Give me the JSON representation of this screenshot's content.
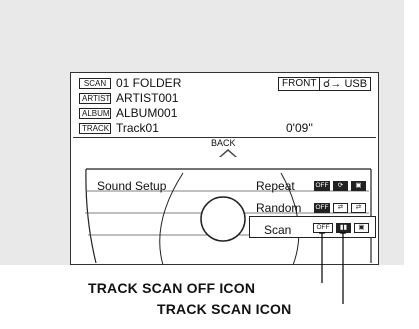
{
  "screen": {
    "rows": [
      {
        "tag": "SCAN",
        "text": "01 FOLDER"
      },
      {
        "tag": "ARTIST",
        "text": "ARTIST001"
      },
      {
        "tag": "ALBUM",
        "text": "ALBUM001"
      },
      {
        "tag": "TRACK",
        "text": "Track01"
      }
    ],
    "time": "0'09''",
    "source_front": "FRONT",
    "source_usb": "USB",
    "back_label": "BACK"
  },
  "menu": {
    "sound_setup": "Sound Setup",
    "repeat": "Repeat",
    "random": "Random",
    "scan": "Scan",
    "off": "OFF"
  },
  "callouts": {
    "off_icon": "TRACK SCAN OFF ICON",
    "scan_icon": "TRACK SCAN ICON"
  }
}
